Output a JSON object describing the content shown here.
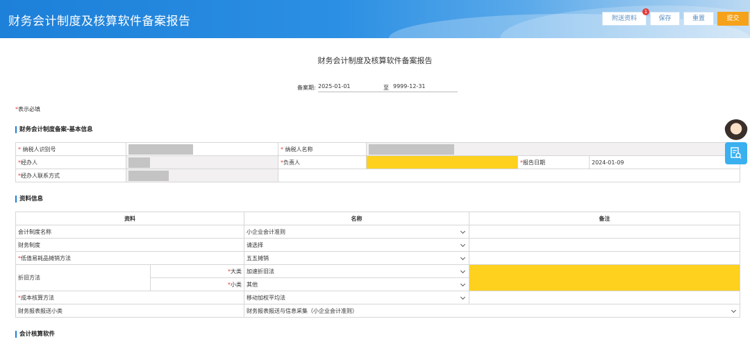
{
  "header": {
    "title": "财务会计制度及核算软件备案报告",
    "buttons": {
      "attach": "附送资料",
      "save": "保存",
      "reset": "重置",
      "submit": "提交"
    },
    "attach_badge": "1"
  },
  "form": {
    "title": "财务会计制度及核算软件备案报告",
    "period_label": "备案期:",
    "period_start": "2025-01-01",
    "period_to": "至",
    "period_end": "9999-12-31",
    "required_note": "表示必填",
    "required_star": "*"
  },
  "basic_info": {
    "section_title": "财务会计制度备案-基本信息",
    "taxpayer_id_label": "纳税人识别号",
    "taxpayer_name_label": "纳税人名称",
    "handler_label": "经办人",
    "responsible_label": "负责人",
    "report_date_label": "报告日期",
    "report_date_value": "2024-01-09",
    "handler_contact_label": "经办人联系方式"
  },
  "material_info": {
    "section_title": "资料信息",
    "headers": [
      "资料",
      "名称",
      "备注"
    ],
    "rows": {
      "accounting_system_name": {
        "label": "会计制度名称",
        "value": "小企业会计准则"
      },
      "financial_system": {
        "label": "财务制度",
        "value": "请选择"
      },
      "low_value_method": {
        "label": "低值易耗品摊销方法",
        "value": "五五摊销"
      },
      "depreciation": {
        "label": "折旧方法",
        "major_label": "大类",
        "major_value": "加速折旧法",
        "minor_label": "小类",
        "minor_value": "其他"
      },
      "cost_method": {
        "label": "成本核算方法",
        "value": "移动加权平均法"
      },
      "report_subtype": {
        "label": "财务报表报送小类",
        "value": "财务报表报送与信息采集（小企业会计准则）"
      }
    }
  },
  "software_section": {
    "section_title": "会计核算软件"
  },
  "colors": {
    "header_blue": "#1d80d9",
    "submit_orange": "#f5a21a",
    "highlight_yellow": "#fdd11d",
    "required_red": "#e23b3b"
  }
}
